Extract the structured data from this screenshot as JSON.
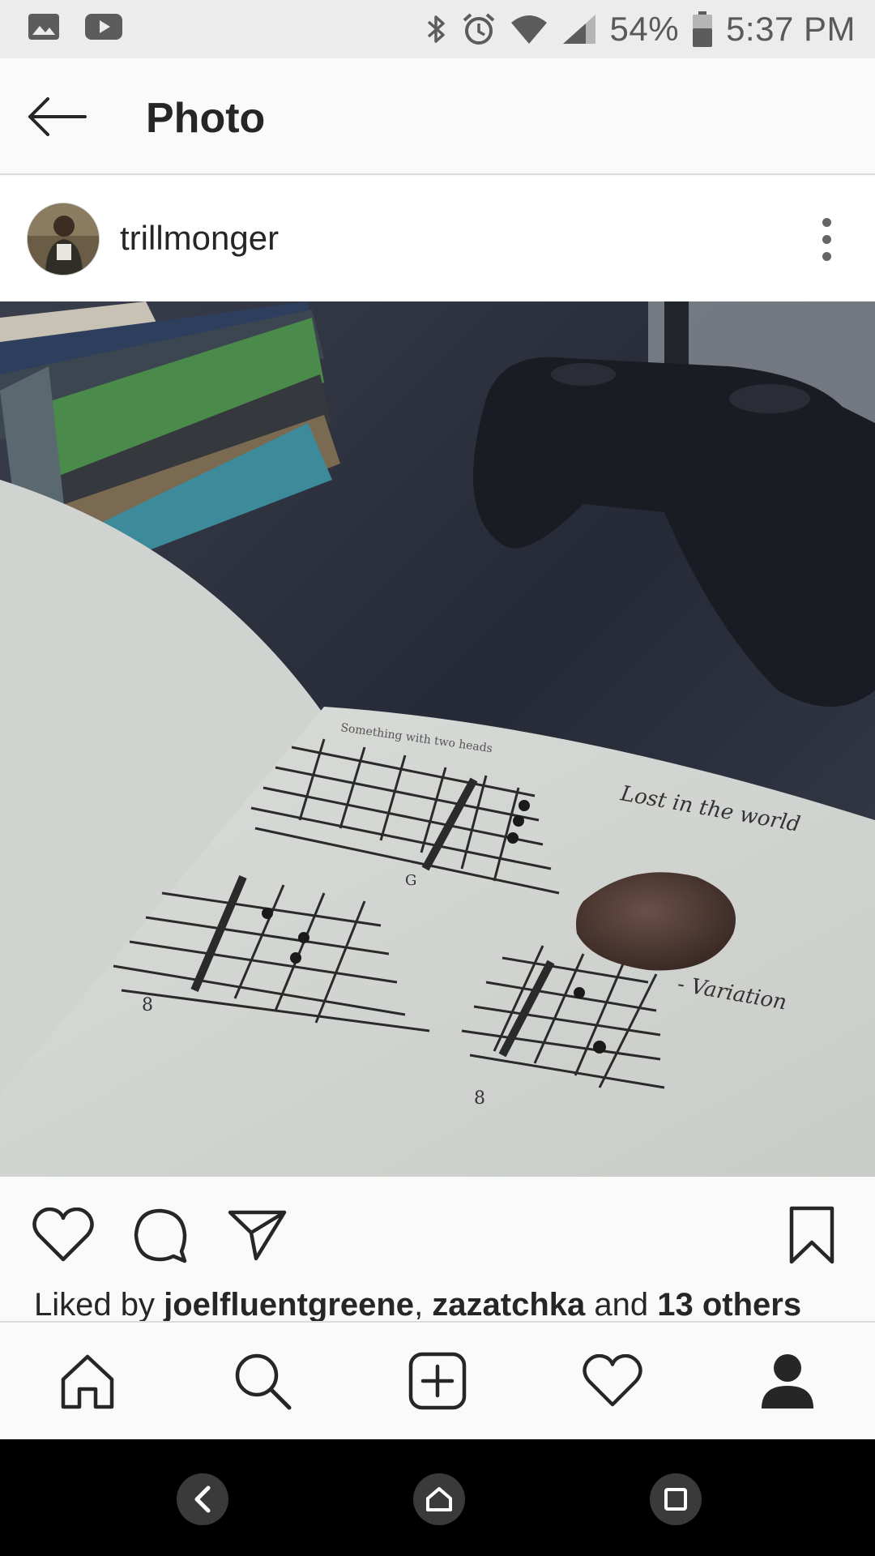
{
  "status_bar": {
    "battery": "54%",
    "time": "5:37 PM",
    "left_icons": [
      "gallery-icon",
      "youtube-icon"
    ],
    "right_icons": [
      "bluetooth-icon",
      "alarm-icon",
      "wifi-icon",
      "signal-icon",
      "battery-icon"
    ]
  },
  "header": {
    "title": "Photo"
  },
  "post": {
    "username": "trillmonger",
    "likes": {
      "prefix": "Liked by ",
      "user1": "joelfluentgreene",
      "separator": ", ",
      "user2": "zazatchka",
      "conjunction": " and ",
      "others": "13 others"
    },
    "photo_notes": {
      "caption_top": "Something with two heads",
      "note_right": "Lost in the world",
      "variation": "- Variation",
      "fret_g": "G",
      "fret_8a": "8",
      "fret_8b": "8"
    }
  },
  "actions": [
    "heart-icon",
    "comment-icon",
    "share-icon",
    "bookmark-icon"
  ],
  "bottom_nav": [
    "home-icon",
    "search-icon",
    "add-post-icon",
    "activity-heart-icon",
    "profile-icon"
  ],
  "system_nav": [
    "back-icon",
    "home-icon",
    "recents-icon"
  ]
}
